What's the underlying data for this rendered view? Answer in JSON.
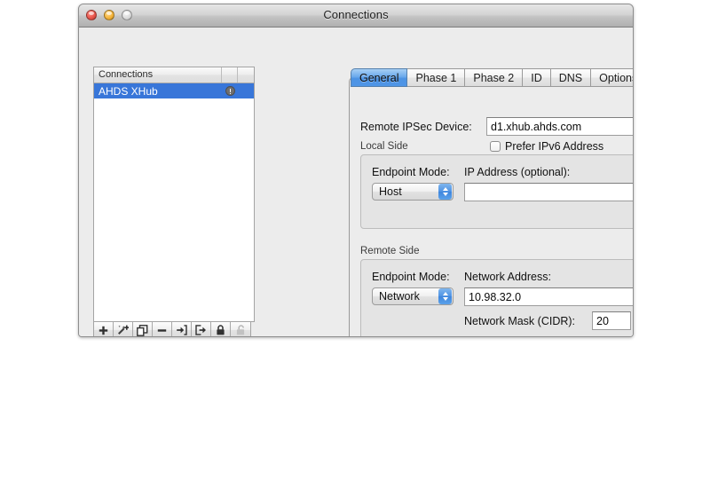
{
  "window": {
    "title": "Connections",
    "traffic_lights": [
      {
        "name": "close-button",
        "color": "#e8564c"
      },
      {
        "name": "minimize-button",
        "color": "#f5b53c"
      },
      {
        "name": "zoom-button",
        "color": "#dcdcdc"
      }
    ]
  },
  "list": {
    "header": "Connections",
    "rows": [
      {
        "label": "AHDS XHub",
        "selected": true,
        "status_icon": "alert-exclamation-icon"
      }
    ],
    "toolbar": [
      {
        "name": "add-connection-button",
        "icon": "plus-icon"
      },
      {
        "name": "wizard-add-connection-button",
        "icon": "magic-wand-plus-icon"
      },
      {
        "name": "duplicate-connection-button",
        "icon": "copy-icon"
      },
      {
        "name": "remove-connection-button",
        "icon": "minus-icon"
      },
      {
        "name": "import-connection-button",
        "icon": "import-arrow-icon"
      },
      {
        "name": "export-connection-button",
        "icon": "export-arrow-icon"
      },
      {
        "name": "lock-button",
        "icon": "lock-closed-icon"
      },
      {
        "name": "unlock-button",
        "icon": "lock-open-icon"
      }
    ]
  },
  "tabs": [
    {
      "label": "General",
      "selected": true
    },
    {
      "label": "Phase 1",
      "selected": false
    },
    {
      "label": "Phase 2",
      "selected": false
    },
    {
      "label": "ID",
      "selected": false
    },
    {
      "label": "DNS",
      "selected": false
    },
    {
      "label": "Options",
      "selected": false
    }
  ],
  "general": {
    "remote_device_label": "Remote IPSec Device:",
    "remote_device_value": "d1.xhub.ahds.com",
    "remote_device_placeholder": "",
    "prefer_ipv6_label": "Prefer IPv6 Address",
    "prefer_ipv6_checked": false,
    "local_side": {
      "group_label": "Local Side",
      "endpoint_mode_label": "Endpoint Mode:",
      "endpoint_mode_value": "Host",
      "address_label": "IP Address (optional):",
      "address_value": "",
      "address_placeholder": ""
    },
    "remote_side": {
      "group_label": "Remote Side",
      "endpoint_mode_label": "Endpoint Mode:",
      "endpoint_mode_value": "Network",
      "address_label": "Network Address:",
      "address_value": "10.98.32.0",
      "address_placeholder": "",
      "mask_label": "Network Mask (CIDR):",
      "mask_value": "20",
      "mask_placeholder": ""
    }
  },
  "colors": {
    "selection_blue": "#3876d9",
    "tab_active_blue": "#4c93e4",
    "window_bg": "#ececec",
    "group_bg": "#e4e4e4"
  }
}
